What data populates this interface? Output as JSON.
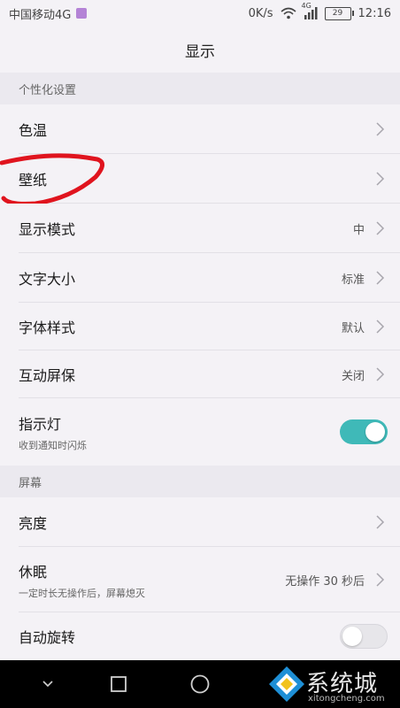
{
  "status_bar": {
    "carrier": "中国移动4G",
    "speed": "0K/s",
    "network_type": "4G",
    "battery": "29",
    "time": "12:16"
  },
  "header": {
    "title": "显示"
  },
  "sections": {
    "personalization": "个性化设置",
    "screen": "屏幕"
  },
  "rows": {
    "color_temp": {
      "label": "色温"
    },
    "wallpaper": {
      "label": "壁纸"
    },
    "display_mode": {
      "label": "显示模式",
      "value": "中"
    },
    "font_size": {
      "label": "文字大小",
      "value": "标准"
    },
    "font_style": {
      "label": "字体样式",
      "value": "默认"
    },
    "screensaver": {
      "label": "互动屏保",
      "value": "关闭"
    },
    "indicator": {
      "label": "指示灯",
      "sub": "收到通知时闪烁",
      "toggle": "on"
    },
    "brightness": {
      "label": "亮度"
    },
    "sleep": {
      "label": "休眠",
      "sub": "一定时长无操作后，屏幕熄灭",
      "value": "无操作 30 秒后"
    },
    "auto_rotate": {
      "label": "自动旋转",
      "toggle": "off"
    }
  },
  "annotation": {
    "color": "#e0141e",
    "target": "wallpaper"
  },
  "colors": {
    "accent": "#3fb9b8",
    "background": "#f4f2f6"
  },
  "watermark": {
    "logo": "系统城",
    "url": "xitongcheng.com"
  },
  "icons": [
    "wifi-icon",
    "signal-icon",
    "chevron-right-icon",
    "back-icon",
    "home-icon",
    "recents-icon"
  ]
}
